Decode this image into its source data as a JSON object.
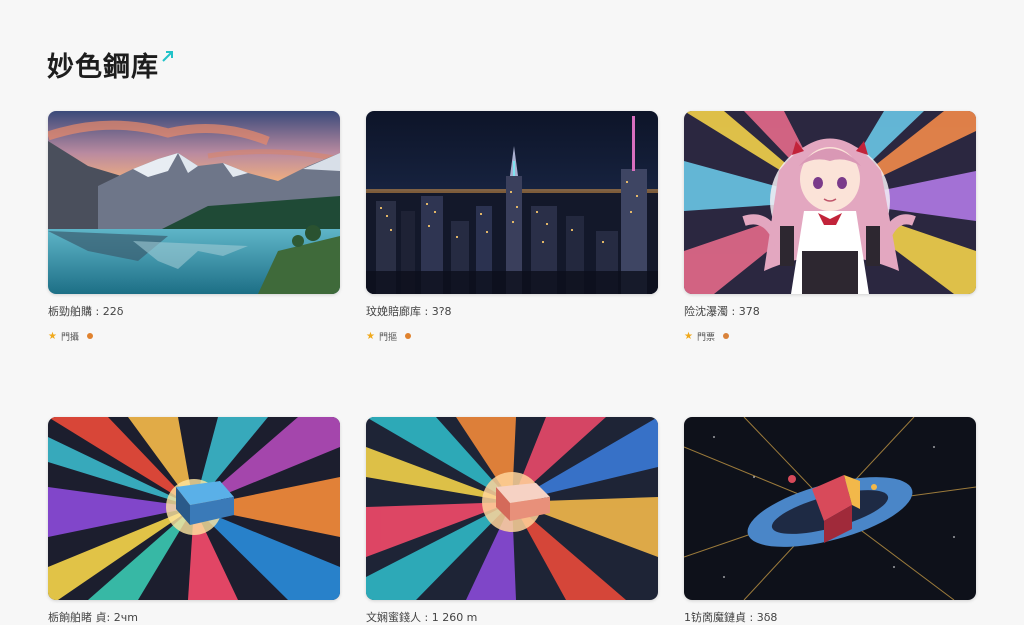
{
  "page": {
    "title": "妙色鋼库"
  },
  "icons": {
    "title_accent": "teal-arrow-icon",
    "rating": "star-icon"
  },
  "colors": {
    "accent_teal": "#22c3c9",
    "star": "#f0a91c"
  },
  "cards": [
    {
      "caption": "栃勁舶購 : 22δ",
      "tag": "門攝",
      "dot_color": "#e0822e"
    },
    {
      "caption": "玟娩賠廊库 : 3?8",
      "tag": "門摳",
      "dot_color": "#e0822e"
    },
    {
      "caption": "险沈瀑濁 : 378",
      "tag": "門票",
      "dot_color": "#d9823a"
    },
    {
      "caption": "栃餉舶睹 貞: 2чm",
      "tag": "",
      "dot_color": ""
    },
    {
      "caption": "文娴蜜錢人 : 1 260 m",
      "tag": "",
      "dot_color": ""
    },
    {
      "caption": "1钫啇魔鏈貞 : 3δ8",
      "tag": "",
      "dot_color": ""
    }
  ]
}
